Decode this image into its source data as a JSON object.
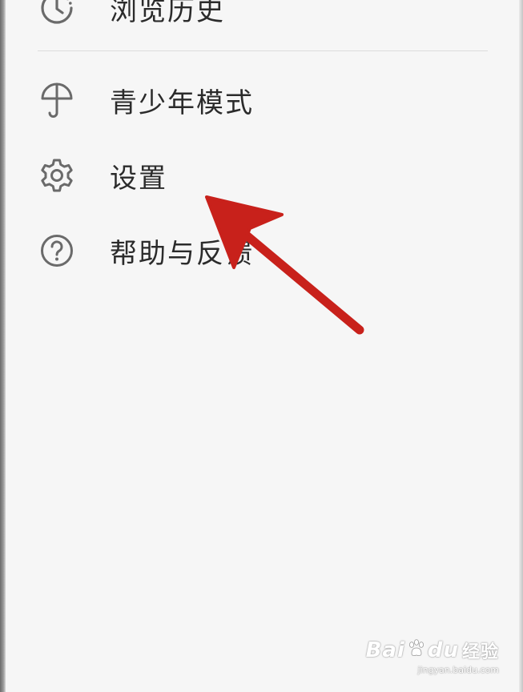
{
  "menu": {
    "items": [
      {
        "label": "浏览历史",
        "icon": "history-icon"
      },
      {
        "label": "青少年模式",
        "icon": "umbrella-icon"
      },
      {
        "label": "设置",
        "icon": "gear-icon"
      },
      {
        "label": "帮助与反馈",
        "icon": "help-icon"
      }
    ]
  },
  "watermark": {
    "brand_left": "Bai",
    "brand_right": "du",
    "brand_cn": "经验",
    "url": "jingyan.baidu.com"
  },
  "colors": {
    "background": "#f6f6f6",
    "text": "#2b2b2b",
    "icon": "#6a6a6a",
    "arrow": "#c8211b"
  }
}
